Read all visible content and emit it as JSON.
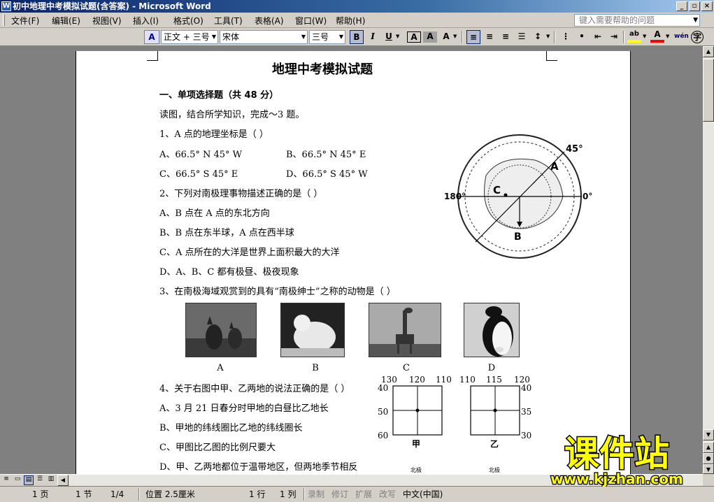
{
  "window": {
    "title": "初中地理中考模拟试题(含答案) - Microsoft Word",
    "btn_min": "_",
    "btn_max": "▫",
    "btn_close": "×"
  },
  "menu": {
    "items": [
      "文件(F)",
      "编辑(E)",
      "视图(V)",
      "插入(I)",
      "格式(O)",
      "工具(T)",
      "表格(A)",
      "窗口(W)",
      "帮助(H)"
    ],
    "help_placeholder": "键入需要帮助的问题"
  },
  "toolbar": {
    "style_value": "正文 + 三号",
    "font_value": "宋体",
    "size_value": "三号",
    "bold": "B",
    "italic": "I",
    "underline": "U",
    "char_border": "A",
    "char_shade": "A",
    "scale": "A",
    "font_color": "A",
    "highlight": "ab",
    "phonetic": "wén"
  },
  "document": {
    "title": "地理中考模拟试题",
    "section1": "一、单项选择题（共 48 分）",
    "intro": "读图，结合所学知识，完成～3 题。",
    "q1": "1、A 点的地理坐标是（    ）",
    "q1_a": "A、66.5° N  45° W",
    "q1_b": "B、66.5° N   45° E",
    "q1_c": "C、66.5° S  45° E",
    "q1_d": "D、66.5° S   45° W",
    "q2": "2、下列对南极理事物描述正确的是（    ）",
    "q2_a": "A、B 点在 A 点的东北方向",
    "q2_b": "B、B 点在东半球，A 点在西半球",
    "q2_c": "C、A 点所在的大洋是世界上面积最大的大洋",
    "q2_d": "D、A、B、C 都有极昼、极夜现象",
    "q3": "3、在南极海域观赏到的具有“南极绅士”之称的动物是（    ）",
    "photo_labels": [
      "A",
      "B",
      "C",
      "D"
    ],
    "q4": "4、关于右图中甲、乙两地的说法正确的是（    ）",
    "q4_a": "A、3 月 21 日春分时甲地的白昼比乙地长",
    "q4_b": "B、甲地的纬线圈比乙地的纬线圈长",
    "q4_c": "C、甲图比乙图的比例尺要大",
    "q4_d": "D、甲、乙两地都位于温带地区，但两地季节相反",
    "map_labels": {
      "deg45": "45°",
      "A": "A",
      "C": "C",
      "B": "B",
      "deg180": "180°",
      "deg0": "0°"
    },
    "grid_left": {
      "top": [
        "130",
        "120",
        "110"
      ],
      "side": [
        "40",
        "50",
        "60"
      ],
      "name": "甲",
      "pole": "北极"
    },
    "grid_right": {
      "top": [
        "110",
        "115",
        "120"
      ],
      "side": [
        "40",
        "35",
        "30"
      ],
      "name": "乙",
      "pole": "北极"
    }
  },
  "statusbar": {
    "page": "1 页",
    "section": "1 节",
    "pages": "1/4",
    "position": "位置 2.5厘米",
    "line": "1 行",
    "col": "1 列",
    "rec": "录制",
    "trk": "修订",
    "ext": "扩展",
    "ovr": "改写",
    "lang": "中文(中国)"
  },
  "watermark": {
    "title": "课件站",
    "url": "www.kjzhan.com"
  }
}
